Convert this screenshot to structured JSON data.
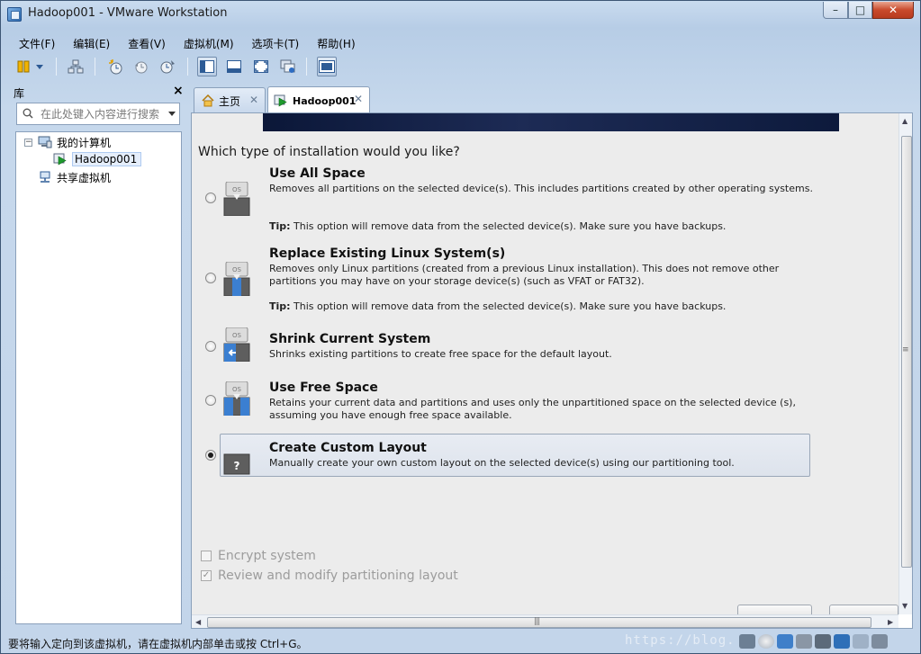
{
  "window": {
    "title": "Hadoop001 - VMware Workstation",
    "controls": {
      "minimize": "–",
      "maximize": "□",
      "close": "✕"
    }
  },
  "menu": [
    "文件(F)",
    "编辑(E)",
    "查看(V)",
    "虚拟机(M)",
    "选项卡(T)",
    "帮助(H)"
  ],
  "library": {
    "title": "库",
    "close": "×",
    "search_placeholder": "在此处键入内容进行搜索",
    "tree": {
      "my_computer": "我的计算机",
      "vm": "Hadoop001",
      "shared": "共享虚拟机",
      "expander": "−"
    }
  },
  "tabs": {
    "home": "主页",
    "vm": "Hadoop001",
    "close": "✕"
  },
  "installer": {
    "question": "Which type of installation would you like?",
    "os_label": "OS",
    "tip_label": "Tip:",
    "options": [
      {
        "title": "Use All Space",
        "desc": "Removes all partitions on the selected device(s).  This includes partitions created by other operating systems.",
        "tip": "This option will remove data from the selected device(s).  Make sure you have backups."
      },
      {
        "title": "Replace Existing Linux System(s)",
        "desc": "Removes only Linux partitions (created from a previous Linux installation).  This does not remove other partitions you may have on your storage device(s) (such as VFAT or FAT32).",
        "tip": "This option will remove data from the selected device(s).  Make sure you have backups."
      },
      {
        "title": "Shrink Current System",
        "desc": "Shrinks existing partitions to create free space for the default layout."
      },
      {
        "title": "Use Free Space",
        "desc": "Retains your current data and partitions and uses only the unpartitioned space on the selected device (s), assuming you have enough free space available."
      },
      {
        "title": "Create Custom Layout",
        "desc": "Manually create your own custom layout on the selected device(s) using our partitioning tool.",
        "icon_glyph": "?"
      }
    ],
    "selected_option": 4,
    "encrypt_label": "Encrypt system",
    "review_label": "Review and modify partitioning layout",
    "check_mark": "✓"
  },
  "scroll": {
    "up": "▲",
    "down": "▼",
    "left": "◀",
    "right": "▶",
    "grip": "|||"
  },
  "status": {
    "text": "要将输入定向到该虚拟机，请在虚拟机内部单击或按 Ctrl+G。",
    "watermark": "https://blog."
  },
  "colors": {
    "accent": "#1d6fd1",
    "banner": "#0b1738",
    "selected_option_bg": "#e3e8f0"
  }
}
